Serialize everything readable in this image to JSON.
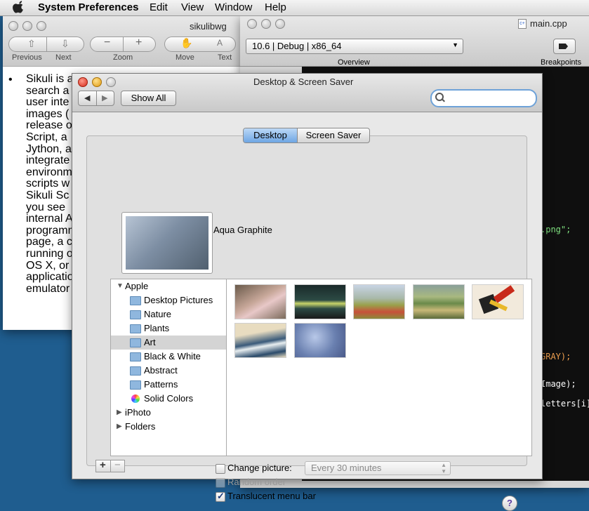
{
  "menubar": {
    "items": [
      "System Preferences",
      "Edit",
      "View",
      "Window",
      "Help"
    ]
  },
  "doc_window": {
    "title": "sikulibwg",
    "toolbar": {
      "previous": "Previous",
      "next": "Next",
      "zoom": "Zoom",
      "move": "Move",
      "text": "Text"
    },
    "text_lines": [
      "Sikuli is a",
      "search a",
      "user inte",
      "images (",
      "release o",
      "Script, a",
      "Jython, a",
      "integrate",
      "environm",
      "scripts w",
      "Sikuli Sc",
      "you see",
      "internal A",
      "programm",
      "page, a c",
      "running o",
      "OS X, or",
      "applicatio",
      "emulator"
    ]
  },
  "xcode": {
    "file_title": "main.cpp",
    "scheme": "10.6 | Debug | x86_64",
    "overview_label": "Overview",
    "breakpoints_label": "Breakpoints",
    "code_fragments": [
      ".png\";",
      "GRAY);",
      "Image);",
      "letters[i]"
    ]
  },
  "dss": {
    "title": "Desktop & Screen Saver",
    "show_all": "Show All",
    "search_placeholder": "",
    "tabs": {
      "desktop": "Desktop",
      "screen_saver": "Screen Saver"
    },
    "current_picture": "Aqua Graphite",
    "sidebar": {
      "apple": "Apple",
      "items": [
        "Desktop Pictures",
        "Nature",
        "Plants",
        "Art",
        "Black & White",
        "Abstract",
        "Patterns",
        "Solid Colors"
      ],
      "iphoto": "iPhoto",
      "folders": "Folders"
    },
    "thumbnails": [
      "dancer-painting",
      "night-diner-painting",
      "poppy-field-painting",
      "island-sunday-painting",
      "suprematist-painting",
      "great-wave-print",
      "water-lilies-painting"
    ],
    "change_picture": "Change picture:",
    "interval": "Every 30 minutes",
    "random_order": "Random order",
    "translucent": "Translucent menu bar",
    "add": "+",
    "remove": "−",
    "help": "?"
  }
}
